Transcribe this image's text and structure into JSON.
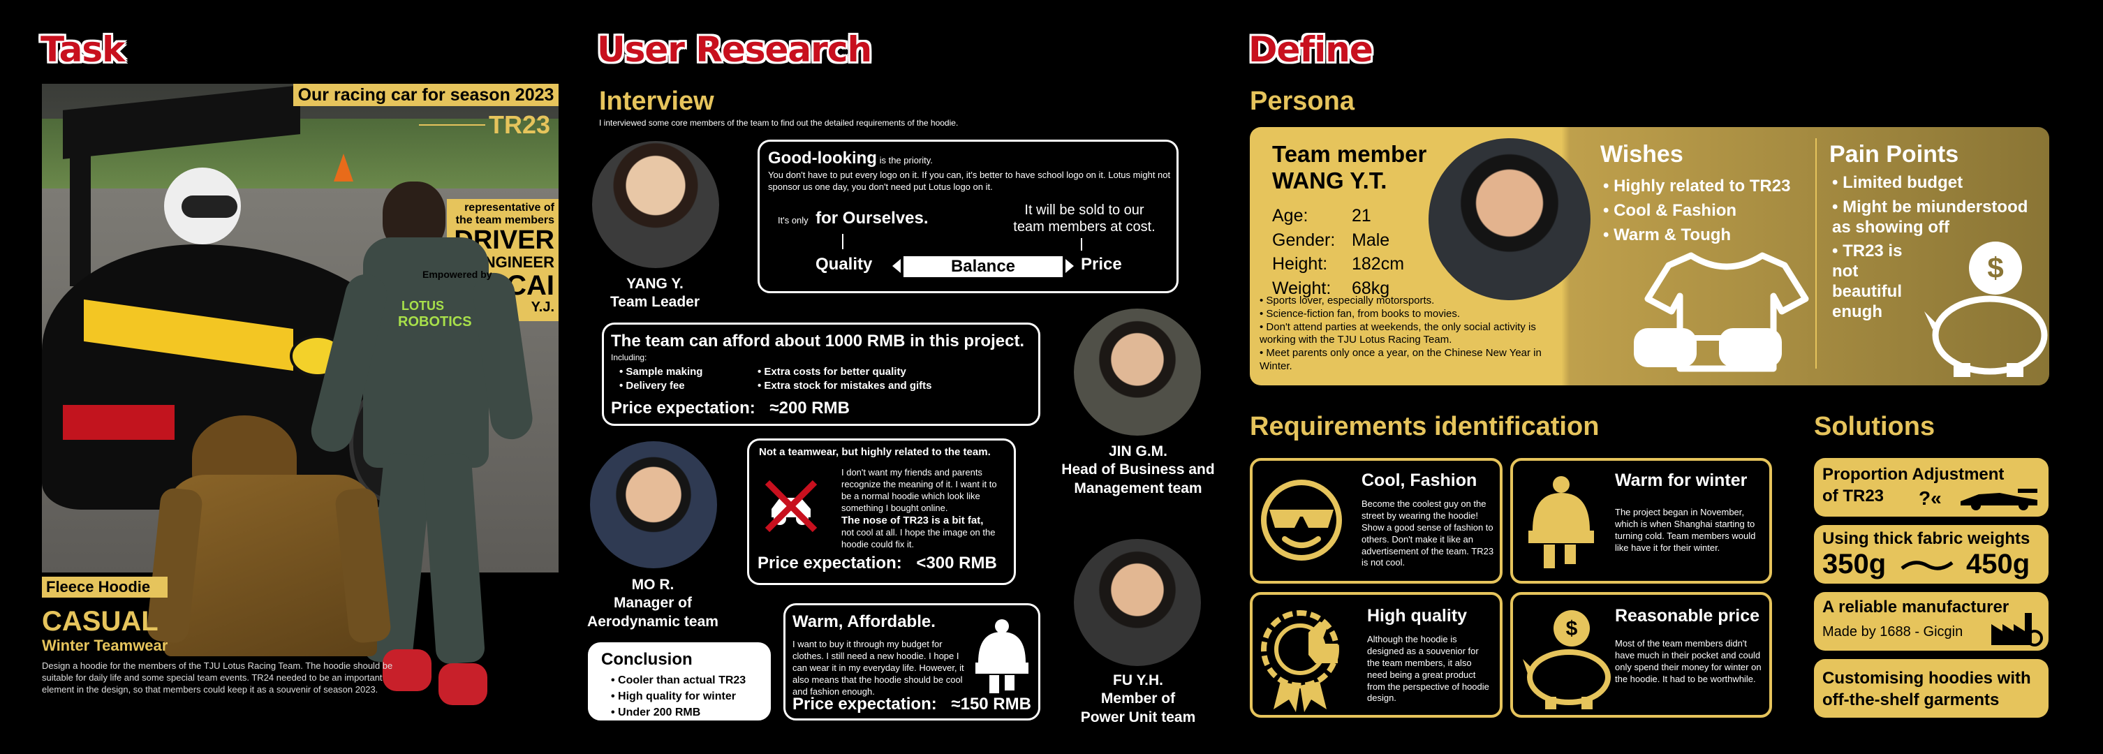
{
  "colors": {
    "brand_red": "#c8101e",
    "gold": "#e6c45c",
    "gold_dark": "#8a7535",
    "bg": "#000000"
  },
  "task": {
    "title": "Task",
    "banner": "Our racing car for season 2023",
    "car_name": "TR23",
    "representative_line1": "representative of",
    "representative_line2": "the team members",
    "driver": "DRIVER",
    "engineer": "ENGINEER",
    "cai": "CAI",
    "yj": "Y.J.",
    "suit_text1": "Empowered by",
    "suit_text2": "LOTUS",
    "suit_text3": "ROBOTICS",
    "fleece_label": "Fleece Hoodie",
    "casual": "CASUAL",
    "winter": "Winter Teamwear",
    "description": "Design a hoodie for the members of the TJU Lotus Racing Team. The hoodie should be suitable for daily life and some special team events. TR24 needed to be an important element in the design, so that members could keep it as a souvenir of season 2023."
  },
  "research": {
    "title": "User Research",
    "interview_heading": "Interview",
    "interview_intro": "I interviewed some core members of the team to find out the detailed requirements of the hoodie.",
    "yang": {
      "name": "YANG Y.",
      "role": "Team Leader",
      "bubble_title": "Good-looking",
      "bubble_title_suffix": " is the priority.",
      "bubble_body": "You don't have to put every logo on it. If you can, it's better to have school logo on it. Lotus might not sponsor us one day, you don't need put Lotus logo on it.",
      "its_only": "It's only",
      "for_ourselves": "for Ourselves.",
      "sold_line1": "It will be sold to our",
      "sold_line2": "team members at cost.",
      "quality": "Quality",
      "balance": "Balance",
      "price": "Price"
    },
    "jin": {
      "name": "JIN G.M.",
      "role_line1": "Head of Business and",
      "role_line2": "Management team",
      "bubble_title": "The team can afford about 1000 RMB in this project.",
      "including": "Including:",
      "left_items": [
        "Sample making",
        "Delivery fee"
      ],
      "right_items": [
        "Extra costs for better quality",
        "Extra stock for mistakes and gifts"
      ],
      "price_label": "Price expectation:",
      "price_value": "≈200 RMB"
    },
    "mo": {
      "name": "MO R.",
      "role_line1": "Manager of",
      "role_line2": "Aerodynamic team",
      "bubble_title": "Not a teamwear, but highly related to the team.",
      "body1": "I don't want my friends and parents recognize the meaning of it. I want it to be a normal hoodie which look like something I bought online.",
      "body2_bold": "The nose of TR23 is a bit fat,",
      "body2": "not cool at all. I hope the image on the hoodie could fix it.",
      "price_label": "Price expectation:",
      "price_value": "<300 RMB"
    },
    "fu": {
      "name": "FU Y.H.",
      "role_line1": "Member of",
      "role_line2": "Power Unit team",
      "bubble_title": "Warm, Affordable.",
      "body": "I want to buy it through my budget for clothes. I still need a new hoodie. I hope I can wear it in my everyday life. However, it also means that the hoodie should be cool and fashion enough.",
      "price_label": "Price expectation:",
      "price_value": "≈150 RMB"
    },
    "conclusion": {
      "title": "Conclusion",
      "items": [
        "Cooler than actual TR23",
        "High quality for winter",
        "Under 200 RMB"
      ]
    }
  },
  "define": {
    "title": "Define",
    "persona_heading": "Persona",
    "persona": {
      "title_line1": "Team member",
      "title_line2": "WANG Y.T.",
      "fields": [
        {
          "label": "Age:",
          "value": "21"
        },
        {
          "label": "Gender:",
          "value": "Male"
        },
        {
          "label": "Height:",
          "value": "182cm"
        },
        {
          "label": "Weight:",
          "value": "68kg"
        }
      ],
      "bullets": [
        "Sports lover, especially motorsports.",
        "Science-fiction fan, from books to movies.",
        "Don't attend parties at weekends, the only social activity is working with the TJU Lotus Racing Team.",
        "Meet parents only once a year, on the Chinese New Year in Winter."
      ],
      "wishes_title": "Wishes",
      "wishes": [
        "Highly related to TR23",
        "Cool & Fashion",
        "Warm & Tough"
      ],
      "pain_title": "Pain Points",
      "pain": [
        "Limited budget",
        "Might be miunderstood as showing off",
        "TR23 is not beautiful enugh"
      ]
    },
    "req_heading": "Requirements identification",
    "requirements": [
      {
        "title": "Cool, Fashion",
        "body": "Become the coolest guy on the street by wearing the hoodie! Show a good sense of fashion to others. Don't make it like an advertisement of the team. TR23 is not cool.",
        "icon": "sunglasses-face-icon"
      },
      {
        "title": "Warm for winter",
        "body": "The project began in November, which is when Shanghai starting to turning cold. Team members would like have it for their winter.",
        "icon": "beanie-icon"
      },
      {
        "title": "High quality",
        "body": "Although the hoodie is designed as a souvenior for the team members, it also need being a great product from the perspective of hoodie design.",
        "icon": "quality-badge-icon"
      },
      {
        "title": "Reasonable price",
        "body": "Most of the team members didn't have much in their pocket and could only spend their money for winter on the hoodie. It had to be worthwhile.",
        "icon": "piggy-bank-icon"
      }
    ],
    "solutions_heading": "Solutions",
    "solutions": {
      "s1_line1": "Proportion Adjustment",
      "s1_line2": "of TR23",
      "s2_title": "Using thick fabric weights",
      "s2_from": "350g",
      "s2_to": "450g",
      "s3_title": "A reliable manufacturer",
      "s3_sub": "Made by 1688 - Gicgin",
      "s4_line1": "Customising hoodies with",
      "s4_line2": "off-the-shelf garments"
    }
  }
}
